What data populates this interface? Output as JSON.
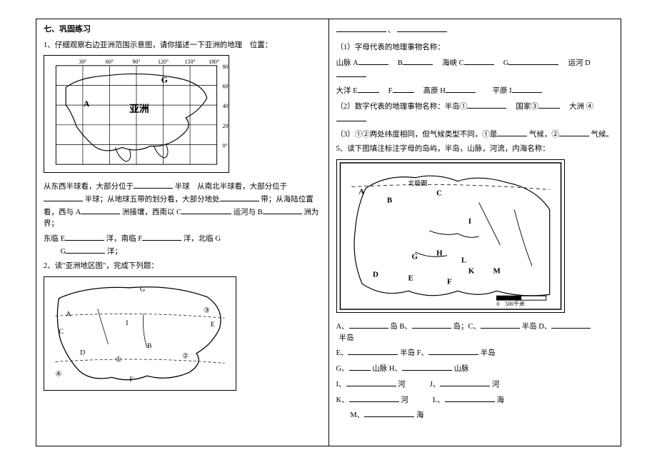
{
  "section_title": "七、巩固练习",
  "left": {
    "q1_intro": "1、仔细观察右边亚洲范围示意图，请你描述一下亚洲的地理　位置：",
    "map1_labels": {
      "l30": "30°",
      "l60": "60°",
      "l90": "90°",
      "l120": "120°",
      "l150": "150°",
      "l180": "180°",
      "lat80": "80°",
      "lat60": "60°",
      "lat40": "40°",
      "lat20": "20°",
      "lat0": "0°",
      "A": "A",
      "G": "G",
      "asia": "亚洲"
    },
    "q1_body1a": "从东西半球看，大部分位于",
    "q1_body1b": "半球　从南北半球看，大部分位于",
    "q1_body2a": "半球；从地球五带的划分看，大部分地处",
    "q1_body2b": "带；从海陆位置看，西与 A",
    "q1_body2c": "洲接壤，西南以 C",
    "q1_body3a": "运河与 B",
    "q1_body3b": "洲为界；",
    "q1_body4a": "东临 E",
    "q1_body4b": "洋，南临 F",
    "q1_body4c": "洋，北临 G",
    "q1_body4d": "洋；",
    "q2_intro": "2、读\"亚洲地区图\"，完成下列题：",
    "map2_labels": {
      "A": "A",
      "B": "B",
      "C": "C",
      "D": "D",
      "E": "E",
      "F": "F",
      "G": "G",
      "n1": "①",
      "n2": "②",
      "n3": "③",
      "n4": "④",
      "I": "I"
    }
  },
  "right": {
    "top_sep": "、",
    "q1_head": "（1）字母代表的地理事物名称：",
    "line_mountain": "山脉 A",
    "line_B": "B",
    "line_strait": "海峡 C",
    "line_G": "G",
    "line_canal": "运河 D",
    "line_oceanE": "大洋 E",
    "line_F": "F",
    "line_plateau": "高原 H",
    "line_plain": "平原 I",
    "q2_head": "（2）数字代表的地理事物名称：半岛①",
    "q2_country": "国家③",
    "q2_continent": "大洲 ④",
    "q3a": "（3）①②两处纬度相同，但气候类型不同，①是",
    "q3b": "气候，②",
    "q3c": "气候。",
    "q5": "5、读下图填注标注字母的岛屿，半岛，山脉，河流，内海名称：",
    "map3_labels": {
      "A": "A",
      "B": "B",
      "C": "C",
      "D": "D",
      "E": "E",
      "F": "F",
      "G": "G",
      "H": "H",
      "I": "I",
      "K": "K",
      "L": "L",
      "M": "M",
      "scale": "0　500千米",
      "arctic": "北极圈"
    },
    "ans_A": "A、",
    "ans_A_suf": "岛 B、",
    "ans_B_suf": "岛；C、",
    "ans_C_suf": "半岛 D、",
    "ans_D_suf": "半岛",
    "ans_E": "E、",
    "ans_E_suf": "半岛 F、",
    "ans_F_suf": "半岛",
    "ans_G": "G、",
    "ans_G_suf": "山脉 H、",
    "ans_H_suf": "山脉",
    "ans_I": "I、",
    "ans_I_suf": "河",
    "ans_J": "J、",
    "ans_J_suf": "河",
    "ans_K": "K、",
    "ans_K_suf": "河",
    "ans_L": "L、",
    "ans_L_suf": "海",
    "ans_M": "M、",
    "ans_M_suf": "海"
  }
}
